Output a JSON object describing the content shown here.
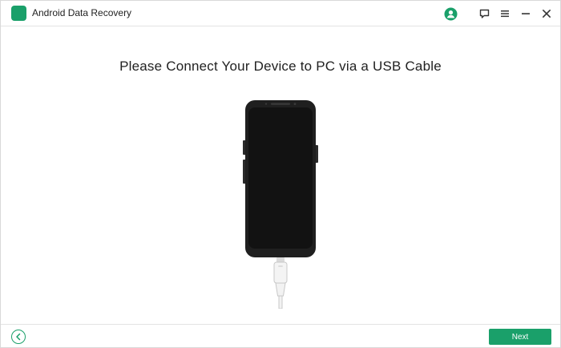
{
  "app": {
    "title": "Android Data Recovery",
    "accent_color": "#1aa06a"
  },
  "titlebar": {
    "icons": [
      "account-icon",
      "feedback-icon",
      "menu-icon",
      "minimize-icon",
      "close-icon"
    ]
  },
  "main": {
    "heading": "Please Connect Your Device to PC via a USB Cable",
    "illustration": "phone-with-usb-cable"
  },
  "footer": {
    "back_icon": "chevron-left-icon",
    "next_label": "Next"
  }
}
